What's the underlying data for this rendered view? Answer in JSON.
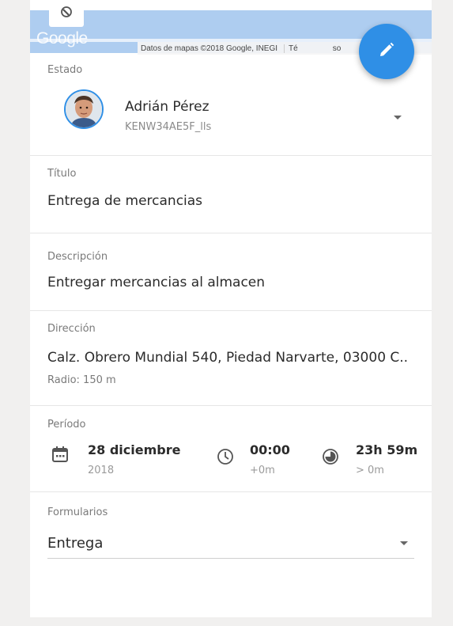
{
  "map": {
    "logo": "Google",
    "attribution": "Datos de mapas ©2018 Google, INEGI",
    "terms": "Té",
    "terms_tail": "so"
  },
  "colors": {
    "accent": "#2f8fe6",
    "map_water": "#aecdf0"
  },
  "icons": {
    "layer": "globe-icon",
    "fab": "edit-pencil-icon",
    "date": "calendar-icon",
    "time": "clock-icon",
    "duration": "timer-icon",
    "caret": "chevron-down-icon"
  },
  "estado": {
    "label": "Estado",
    "user_name": "Adrián Pérez",
    "user_id": "KENW34AE5F_lls"
  },
  "titulo": {
    "label": "Título",
    "value": "Entrega de mercancias"
  },
  "descripcion": {
    "label": "Descripción",
    "value": "Entregar mercancias al almacen"
  },
  "direccion": {
    "label": "Dirección",
    "value": "Calz. Obrero Mundial 540, Piedad Narvarte, 03000 C..",
    "radius": "Radio: 150 m"
  },
  "periodo": {
    "label": "Período",
    "date_main": "28 diciembre",
    "date_sub": "2018",
    "time_main": "00:00",
    "time_sub": "+0m",
    "duration_main": "23h 59m",
    "duration_sub": "> 0m"
  },
  "formularios": {
    "label": "Formularios",
    "selected": "Entrega"
  }
}
